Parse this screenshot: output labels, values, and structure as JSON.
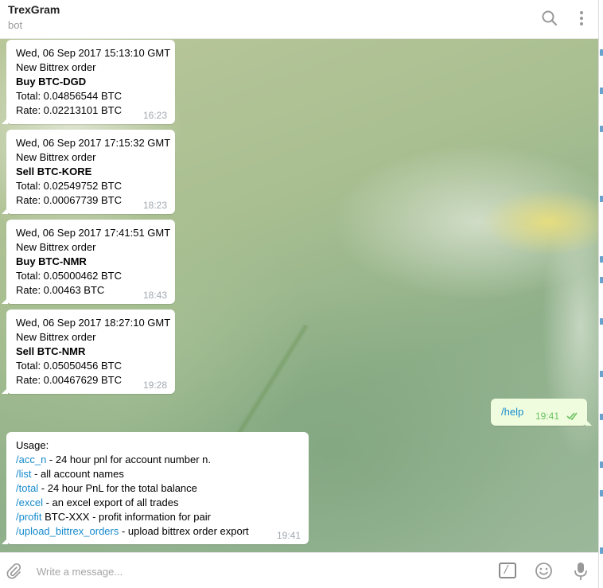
{
  "header": {
    "title": "TrexGram",
    "status": "bot",
    "search_icon": "search-icon",
    "more_icon": "more-vertical-icon"
  },
  "messages": [
    {
      "date": "Wed, 06 Sep 2017 15:13:10 GMT",
      "type": "New Bittrex order",
      "action": "Buy BTC-DGD",
      "total": "Total: 0.04856544 BTC",
      "rate": "Rate: 0.02213101 BTC",
      "time": "16:23"
    },
    {
      "date": "Wed, 06 Sep 2017 17:15:32 GMT",
      "type": "New Bittrex order",
      "action": "Sell BTC-KORE",
      "total": "Total: 0.02549752 BTC",
      "rate": "Rate: 0.00067739 BTC",
      "time": "18:23"
    },
    {
      "date": "Wed, 06 Sep 2017 17:41:51 GMT",
      "type": "New Bittrex order",
      "action": "Buy BTC-NMR",
      "total": "Total: 0.05000462 BTC",
      "rate": "Rate: 0.00463 BTC",
      "time": "18:43"
    },
    {
      "date": "Wed, 06 Sep 2017 18:27:10 GMT",
      "type": "New Bittrex order",
      "action": "Sell BTC-NMR",
      "total": "Total: 0.05050456 BTC",
      "rate": "Rate: 0.00467629 BTC",
      "time": "19:28"
    }
  ],
  "outgoing": {
    "text": "/help",
    "time": "19:41",
    "status_icon": "double-check-icon"
  },
  "usage": {
    "title": "Usage:",
    "commands": [
      {
        "cmd": "/acc_n",
        "desc": " - 24 hour pnl for account number n."
      },
      {
        "cmd": "/list",
        "desc": " - all account names"
      },
      {
        "cmd": "/total",
        "desc": " - 24 hour PnL for the total balance"
      },
      {
        "cmd": "/excel",
        "desc": " - an excel export of all trades"
      },
      {
        "cmd": "/profit",
        "desc": " BTC-XXX - profit information for pair"
      },
      {
        "cmd": "/upload_bittrex_orders",
        "desc": " - upload bittrex order export"
      }
    ],
    "time": "19:41"
  },
  "composer": {
    "placeholder": "Write a message...",
    "value": "",
    "attach_icon": "paperclip-icon",
    "commands_icon": "slash-command-icon",
    "commands_glyph": "/",
    "emoji_icon": "smile-icon",
    "mic_icon": "microphone-icon"
  },
  "colors": {
    "link": "#168acd",
    "outgoing_bubble": "#effdde",
    "outgoing_time": "#6dc264",
    "time_muted": "#a0a8b0"
  }
}
